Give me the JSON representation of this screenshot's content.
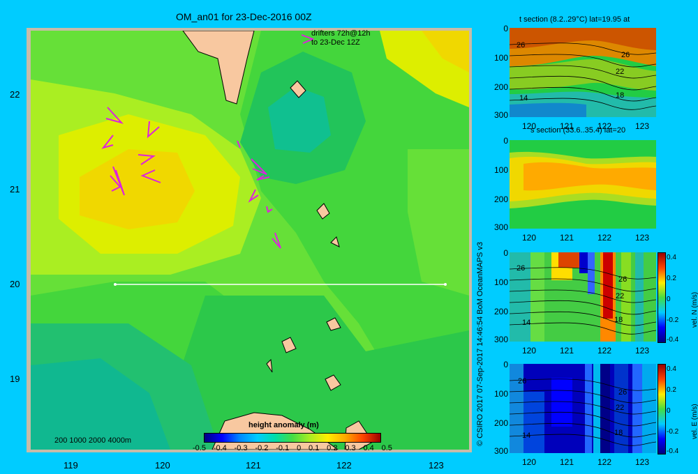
{
  "main": {
    "title": "OM_an01 for 23-Dec-2016 00Z",
    "drifters_line1": "drifters 72h@12h",
    "drifters_line2": "to 23-Dec 12Z",
    "lat_ticks": [
      "22",
      "21",
      "20",
      "19"
    ],
    "lon_ticks": [
      "119",
      "120",
      "121",
      "122",
      "123"
    ],
    "depth_legend": "200  1000  2000  4000m",
    "colorbar_title": "height anomaly (m)",
    "colorbar_ticks": [
      "-0.5",
      "-0.4",
      "-0.3",
      "-0.2",
      "-0.1",
      "0",
      "0.1",
      "0.2",
      "0.3",
      "0.4",
      "0.5"
    ],
    "section_line": {
      "lat": 20,
      "lon_start": 119.5,
      "lon_end": 123.2
    }
  },
  "credit": "© CSIRO 2017   07-Sep-2017 14:46:54 BoM OceanMAPS v3",
  "panels": [
    {
      "title": "t section (8.2..29°C) lat=19.95 at",
      "depth_ticks": [
        "0",
        "100",
        "200",
        "300"
      ],
      "lon_ticks": [
        "120",
        "121",
        "122",
        "123"
      ],
      "contour_labels": [
        "26",
        "26",
        "22",
        "18",
        "14"
      ]
    },
    {
      "title": "s section (33.6..35.4) lat=20",
      "depth_ticks": [
        "0",
        "100",
        "200",
        "300"
      ],
      "lon_ticks": [
        "120",
        "121",
        "122",
        "123"
      ]
    },
    {
      "title": "",
      "depth_ticks": [
        "0",
        "100",
        "200",
        "300"
      ],
      "lon_ticks": [
        "120",
        "121",
        "122",
        "123"
      ],
      "contour_labels": [
        "26",
        "26",
        "22",
        "18",
        "14"
      ],
      "cbar_ticks": [
        "0.4",
        "0.2",
        "0",
        "-0.2",
        "-0.4"
      ],
      "cbar_label": "vel. N (m/s)"
    },
    {
      "title": "",
      "depth_ticks": [
        "0",
        "100",
        "200",
        "300"
      ],
      "lon_ticks": [
        "120",
        "121",
        "122",
        "123"
      ],
      "contour_labels": [
        "26",
        "26",
        "22",
        "18",
        "14"
      ],
      "cbar_ticks": [
        "0.4",
        "0.2",
        "0",
        "-0.2",
        "-0.4"
      ],
      "cbar_label": "vel. E (m/s)"
    }
  ],
  "colors": {
    "background": "#00ccff",
    "drifter": "#dd22dd",
    "land": "#f8c8a0"
  }
}
